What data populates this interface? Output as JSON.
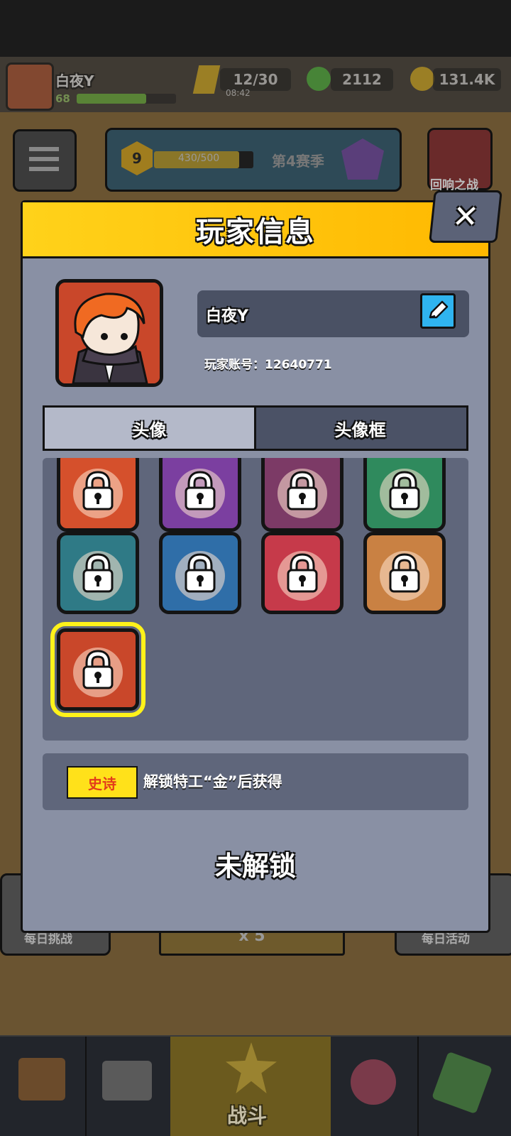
{
  "topbar": {
    "player_name": "白夜Y",
    "player_level": "68",
    "energy": "12/30",
    "energy_timer": "08:42",
    "green_currency": "2112",
    "gold_currency": "131.4K"
  },
  "season_bar": {
    "level": "9",
    "progress_text": "430/500",
    "progress_fraction": 0.86,
    "season_label": "第4赛季"
  },
  "right_event_label": "回响之战",
  "side_labels": {
    "left": "每日挑战",
    "right": "每日活动",
    "center_cost": "x 5"
  },
  "bottom_nav": {
    "battle_label": "战斗"
  },
  "modal": {
    "title": "玩家信息",
    "close_symbol": "✕",
    "player_name": "白夜Y",
    "account_label": "玩家账号：12640771",
    "tabs": [
      "头像",
      "头像框"
    ],
    "active_tab": "头像",
    "avatars": [
      {
        "color": "#d5502c",
        "locked": true,
        "selected": false
      },
      {
        "color": "#7b3fa0",
        "locked": true,
        "selected": false
      },
      {
        "color": "#7c3a66",
        "locked": true,
        "selected": false
      },
      {
        "color": "#2f8a5d",
        "locked": true,
        "selected": false
      },
      {
        "color": "#2f7a86",
        "locked": true,
        "selected": false
      },
      {
        "color": "#2f6ea8",
        "locked": true,
        "selected": false
      },
      {
        "color": "#c63a4a",
        "locked": true,
        "selected": false
      },
      {
        "color": "#c98143",
        "locked": true,
        "selected": false
      },
      {
        "color": "#c9472a",
        "locked": true,
        "selected": true
      }
    ],
    "rarity_label": "史诗",
    "unlock_description": "解锁特工“金”后获得",
    "status_label": "未解锁"
  },
  "colors": {
    "accent_yellow": "#ffd21a",
    "panel": "#8990a4",
    "edit_blue": "#2fb4ef"
  }
}
